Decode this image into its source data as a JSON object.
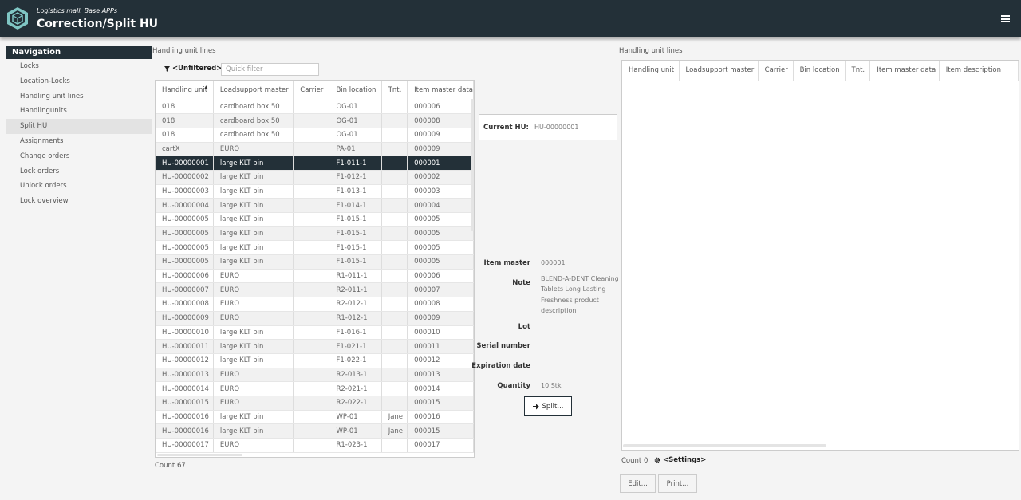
{
  "header": {
    "subtitle": "Logistics mall: Base APPs",
    "title": "Correction/Split HU"
  },
  "nav": {
    "title": "Navigation",
    "items": [
      "Locks",
      "Location-Locks",
      "Handling unit lines",
      "Handlingunits",
      "Split HU",
      "Assignments",
      "Change orders",
      "Lock orders",
      "Unlock orders",
      "Lock overview"
    ],
    "active_index": 4
  },
  "left": {
    "section_title": "Handling unit lines",
    "filter_label": "<Unfiltered>",
    "quick_filter_placeholder": "Quick filter",
    "columns": [
      "Handling unit",
      "Loadsupport master",
      "Carrier",
      "Bin location",
      "Tnt.",
      "Item master data"
    ],
    "selected_index": 4,
    "rows": [
      [
        "018",
        "cardboard box 50",
        "",
        "OG-01",
        "",
        "000006"
      ],
      [
        "018",
        "cardboard box 50",
        "",
        "OG-01",
        "",
        "000008"
      ],
      [
        "018",
        "cardboard box 50",
        "",
        "OG-01",
        "",
        "000009"
      ],
      [
        "cartX",
        "EURO",
        "",
        "PA-01",
        "",
        "000009"
      ],
      [
        "HU-00000001",
        "large KLT bin",
        "",
        "F1-011-1",
        "",
        "000001"
      ],
      [
        "HU-00000002",
        "large KLT bin",
        "",
        "F1-012-1",
        "",
        "000002"
      ],
      [
        "HU-00000003",
        "large KLT bin",
        "",
        "F1-013-1",
        "",
        "000003"
      ],
      [
        "HU-00000004",
        "large KLT bin",
        "",
        "F1-014-1",
        "",
        "000004"
      ],
      [
        "HU-00000005",
        "large KLT bin",
        "",
        "F1-015-1",
        "",
        "000005"
      ],
      [
        "HU-00000005",
        "large KLT bin",
        "",
        "F1-015-1",
        "",
        "000005"
      ],
      [
        "HU-00000005",
        "large KLT bin",
        "",
        "F1-015-1",
        "",
        "000005"
      ],
      [
        "HU-00000005",
        "large KLT bin",
        "",
        "F1-015-1",
        "",
        "000005"
      ],
      [
        "HU-00000006",
        "EURO",
        "",
        "R1-011-1",
        "",
        "000006"
      ],
      [
        "HU-00000007",
        "EURO",
        "",
        "R2-011-1",
        "",
        "000007"
      ],
      [
        "HU-00000008",
        "EURO",
        "",
        "R2-012-1",
        "",
        "000008"
      ],
      [
        "HU-00000009",
        "EURO",
        "",
        "R1-012-1",
        "",
        "000009"
      ],
      [
        "HU-00000010",
        "large KLT bin",
        "",
        "F1-016-1",
        "",
        "000010"
      ],
      [
        "HU-00000011",
        "large KLT bin",
        "",
        "F1-021-1",
        "",
        "000011"
      ],
      [
        "HU-00000012",
        "large KLT bin",
        "",
        "F1-022-1",
        "",
        "000012"
      ],
      [
        "HU-00000013",
        "EURO",
        "",
        "R2-013-1",
        "",
        "000013"
      ],
      [
        "HU-00000014",
        "EURO",
        "",
        "R2-021-1",
        "",
        "000014"
      ],
      [
        "HU-00000015",
        "EURO",
        "",
        "R2-022-1",
        "",
        "000015"
      ],
      [
        "HU-00000016",
        "large KLT bin",
        "",
        "WP-01",
        "Jane",
        "000016"
      ],
      [
        "HU-00000016",
        "large KLT bin",
        "",
        "WP-01",
        "Jane",
        "000015"
      ],
      [
        "HU-00000017",
        "EURO",
        "",
        "R1-023-1",
        "",
        "000017"
      ]
    ],
    "count_text": "Count 67"
  },
  "detail": {
    "current_hu_label": "Current HU:",
    "current_hu_value": "HU-00000001",
    "item_master_label": "Item master",
    "item_master_value": "000001",
    "note_label": "Note",
    "note_value": "BLEND-A-DENT Cleaning Tablets Long Lasting Freshness product description",
    "lot_label": "Lot",
    "serial_label": "Serial number",
    "expiration_label": "Expiration date",
    "quantity_label": "Quantity",
    "quantity_value": "10 Stk",
    "split_button": "Split..."
  },
  "right": {
    "section_title": "Handling unit lines",
    "columns": [
      "Handling unit",
      "Loadsupport master",
      "Carrier",
      "Bin location",
      "Tnt.",
      "Item master data",
      "Item description",
      "I"
    ],
    "count_text": "Count 0",
    "settings_label": "<Settings>",
    "edit_button": "Edit...",
    "print_button": "Print..."
  },
  "colors": {
    "header_bg": "#233038",
    "selected_row": "#233038"
  }
}
